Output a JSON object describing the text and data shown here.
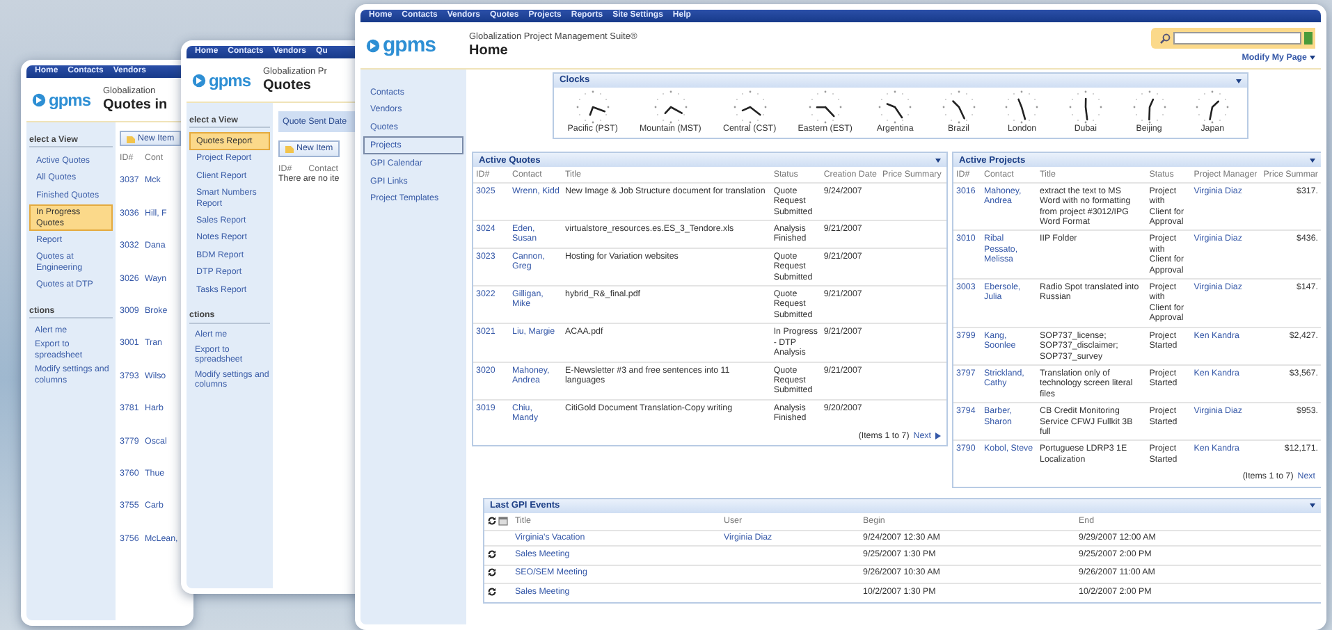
{
  "back_window": {
    "nav_items": [
      "Home",
      "Contacts",
      "Vendors"
    ],
    "logo_text": "gpms",
    "suite_title": "Globalization",
    "page_title": "Quotes in",
    "views_header": "elect a View",
    "views": [
      {
        "label": "Active Quotes",
        "selected": false
      },
      {
        "label": "All Quotes",
        "selected": false
      },
      {
        "label": "Finished Quotes",
        "selected": false
      },
      {
        "label": "In Progress Quotes",
        "selected": true
      },
      {
        "label": "Report",
        "selected": false
      },
      {
        "label": "Quotes at Engineering",
        "selected": false
      },
      {
        "label": "Quotes at DTP",
        "selected": false
      }
    ],
    "actions_header": "ctions",
    "actions": [
      "Alert me",
      "Export to spreadsheet",
      "Modify settings and columns"
    ],
    "new_item": "New Item",
    "columns": [
      "ID#",
      "Cont"
    ],
    "rows": [
      {
        "id": "3037",
        "contact": "Mck"
      },
      {
        "id": "3036",
        "contact": "Hill, F"
      },
      {
        "id": "3032",
        "contact": "Dana"
      },
      {
        "id": "3026",
        "contact": "Wayn"
      },
      {
        "id": "3009",
        "contact": "Broke"
      },
      {
        "id": "3001",
        "contact": "Tran"
      },
      {
        "id": "3793",
        "contact": "Wilso"
      },
      {
        "id": "3781",
        "contact": "Harb"
      },
      {
        "id": "3779",
        "contact": "Oscal"
      },
      {
        "id": "3760",
        "contact": "Thue"
      },
      {
        "id": "3755",
        "contact": "Carb"
      },
      {
        "id": "3756",
        "contact": "McLean,"
      }
    ]
  },
  "middle_window": {
    "nav_items": [
      "Home",
      "Contacts",
      "Vendors",
      "Qu"
    ],
    "logo_text": "gpms",
    "suite_title": "Globalization Pr",
    "page_title": "Quotes",
    "views_header": "elect a View",
    "views": [
      {
        "label": "Quotes Report",
        "selected": true
      },
      {
        "label": "Project Report",
        "selected": false
      },
      {
        "label": "Client Report",
        "selected": false
      },
      {
        "label": "Smart Numbers Report",
        "selected": false
      },
      {
        "label": "Sales Report",
        "selected": false
      },
      {
        "label": "Notes Report",
        "selected": false
      },
      {
        "label": "BDM Report",
        "selected": false
      },
      {
        "label": "DTP Report",
        "selected": false
      },
      {
        "label": "Tasks Report",
        "selected": false
      }
    ],
    "actions_header": "ctions",
    "actions": [
      "Alert me",
      "Export to spreadsheet",
      "Modify settings and columns"
    ],
    "filter_tab": "Quote Sent Date",
    "new_item": "New Item",
    "columns": [
      "ID#",
      "Contact"
    ],
    "empty_message": "There are no ite"
  },
  "front_window": {
    "nav_items": [
      "Home",
      "Contacts",
      "Vendors",
      "Quotes",
      "Projects",
      "Reports",
      "Site Settings",
      "Help"
    ],
    "logo_text": "gpms",
    "suite_title": "Globalization Project Management Suite®",
    "page_title": "Home",
    "modify_link": "Modify My Page",
    "sidebar": [
      {
        "label": "Contacts",
        "selected": false
      },
      {
        "label": "Vendors",
        "selected": false
      },
      {
        "label": "Quotes",
        "selected": false
      },
      {
        "label": "Projects",
        "selected": true
      },
      {
        "label": "GPI Calendar",
        "selected": false
      },
      {
        "label": "GPI Links",
        "selected": false
      },
      {
        "label": "Project Templates",
        "selected": false
      }
    ],
    "clocks": {
      "title": "Clocks",
      "zones": [
        "Pacific (PST)",
        "Mountain (MST)",
        "Central (CST)",
        "Eastern (EST)",
        "Argentina",
        "Brazil",
        "London",
        "Dubai",
        "Beijing",
        "Japan"
      ]
    },
    "active_quotes": {
      "title": "Active Quotes",
      "columns": [
        "ID#",
        "Contact",
        "Title",
        "Status",
        "Creation Date",
        "Price Summary"
      ],
      "rows": [
        {
          "id": "3025",
          "contact": "Wrenn, Kidd",
          "title": "New Image & Job Structure document for translation",
          "status": "Quote Request Submitted",
          "date": "9/24/2007"
        },
        {
          "id": "3024",
          "contact": "Eden, Susan",
          "title": "virtualstore_resources.es.ES_3_Tendore.xls",
          "status": "Analysis Finished",
          "date": "9/21/2007"
        },
        {
          "id": "3023",
          "contact": "Cannon, Greg",
          "title": "Hosting for Variation websites",
          "status": "Quote Request Submitted",
          "date": "9/21/2007"
        },
        {
          "id": "3022",
          "contact": "Gilligan, Mike",
          "title": "hybrid_R&_final.pdf",
          "status": "Quote Request Submitted",
          "date": "9/21/2007"
        },
        {
          "id": "3021",
          "contact": "Liu, Margie",
          "title": "ACAA.pdf",
          "status": "In Progress - DTP Analysis",
          "date": "9/21/2007"
        },
        {
          "id": "3020",
          "contact": "Mahoney, Andrea",
          "title": "E-Newsletter #3 and free sentences into 11 languages",
          "status": "Quote Request Submitted",
          "date": "9/21/2007"
        },
        {
          "id": "3019",
          "contact": "Chiu, Mandy",
          "title": "CitiGold Document Translation-Copy writing",
          "status": "Analysis Finished",
          "date": "9/20/2007"
        }
      ],
      "footer": "(Items 1 to 7)",
      "next": "Next"
    },
    "active_projects": {
      "title": "Active Projects",
      "columns": [
        "ID#",
        "Contact",
        "Title",
        "Status",
        "Project Manager",
        "Price Summar"
      ],
      "rows": [
        {
          "id": "3016",
          "contact": "Mahoney, Andrea",
          "title": "extract the text to MS Word with no formatting from project #3012/IPG Word Format",
          "status": "Project with Client for Approval",
          "manager": "Virginia Diaz",
          "price": "$317."
        },
        {
          "id": "3010",
          "contact": "Ribal Pessato, Melissa",
          "title": "IIP Folder",
          "status": "Project with Client for Approval",
          "manager": "Virginia Diaz",
          "price": "$436."
        },
        {
          "id": "3003",
          "contact": "Ebersole, Julia",
          "title": "Radio Spot translated into Russian",
          "status": "Project with Client for Approval",
          "manager": "Virginia Diaz",
          "price": "$147."
        },
        {
          "id": "3799",
          "contact": "Kang, Soonlee",
          "title": "SOP737_license; SOP737_disclaimer; SOP737_survey",
          "status": "Project Started",
          "manager": "Ken Kandra",
          "price": "$2,427."
        },
        {
          "id": "3797",
          "contact": "Strickland, Cathy",
          "title": "Translation only of technology screen literal files",
          "status": "Project Started",
          "manager": "Ken Kandra",
          "price": "$3,567."
        },
        {
          "id": "3794",
          "contact": "Barber, Sharon",
          "title": "CB Credit Monitoring Service CFWJ Fullkit 3B full",
          "status": "Project Started",
          "manager": "Virginia Diaz",
          "price": "$953."
        },
        {
          "id": "3790",
          "contact": "Kobol, Steve",
          "title": "Portuguese LDRP3 1E Localization",
          "status": "Project Started",
          "manager": "Ken Kandra",
          "price": "$12,171."
        }
      ],
      "footer": "(Items 1 to 7)",
      "next": "Next"
    },
    "last_events": {
      "title": "Last GPI Events",
      "columns": [
        "Title",
        "User",
        "Begin",
        "End"
      ],
      "rows": [
        {
          "title": "Virginia's Vacation",
          "user": "Virginia Diaz",
          "begin": "9/24/2007 12:30 AM",
          "end": "9/29/2007 12:00 AM",
          "recurring": false
        },
        {
          "title": "Sales Meeting",
          "begin": "9/25/2007 1:30 PM",
          "end": "9/25/2007 2:00 PM",
          "recurring": true
        },
        {
          "title": "SEO/SEM Meeting",
          "begin": "9/26/2007 10:30 AM",
          "end": "9/26/2007 11:00 AM",
          "recurring": true
        },
        {
          "title": "Sales Meeting",
          "begin": "10/2/2007 1:30 PM",
          "end": "10/2/2007 2:00 PM",
          "recurring": true
        }
      ]
    }
  }
}
